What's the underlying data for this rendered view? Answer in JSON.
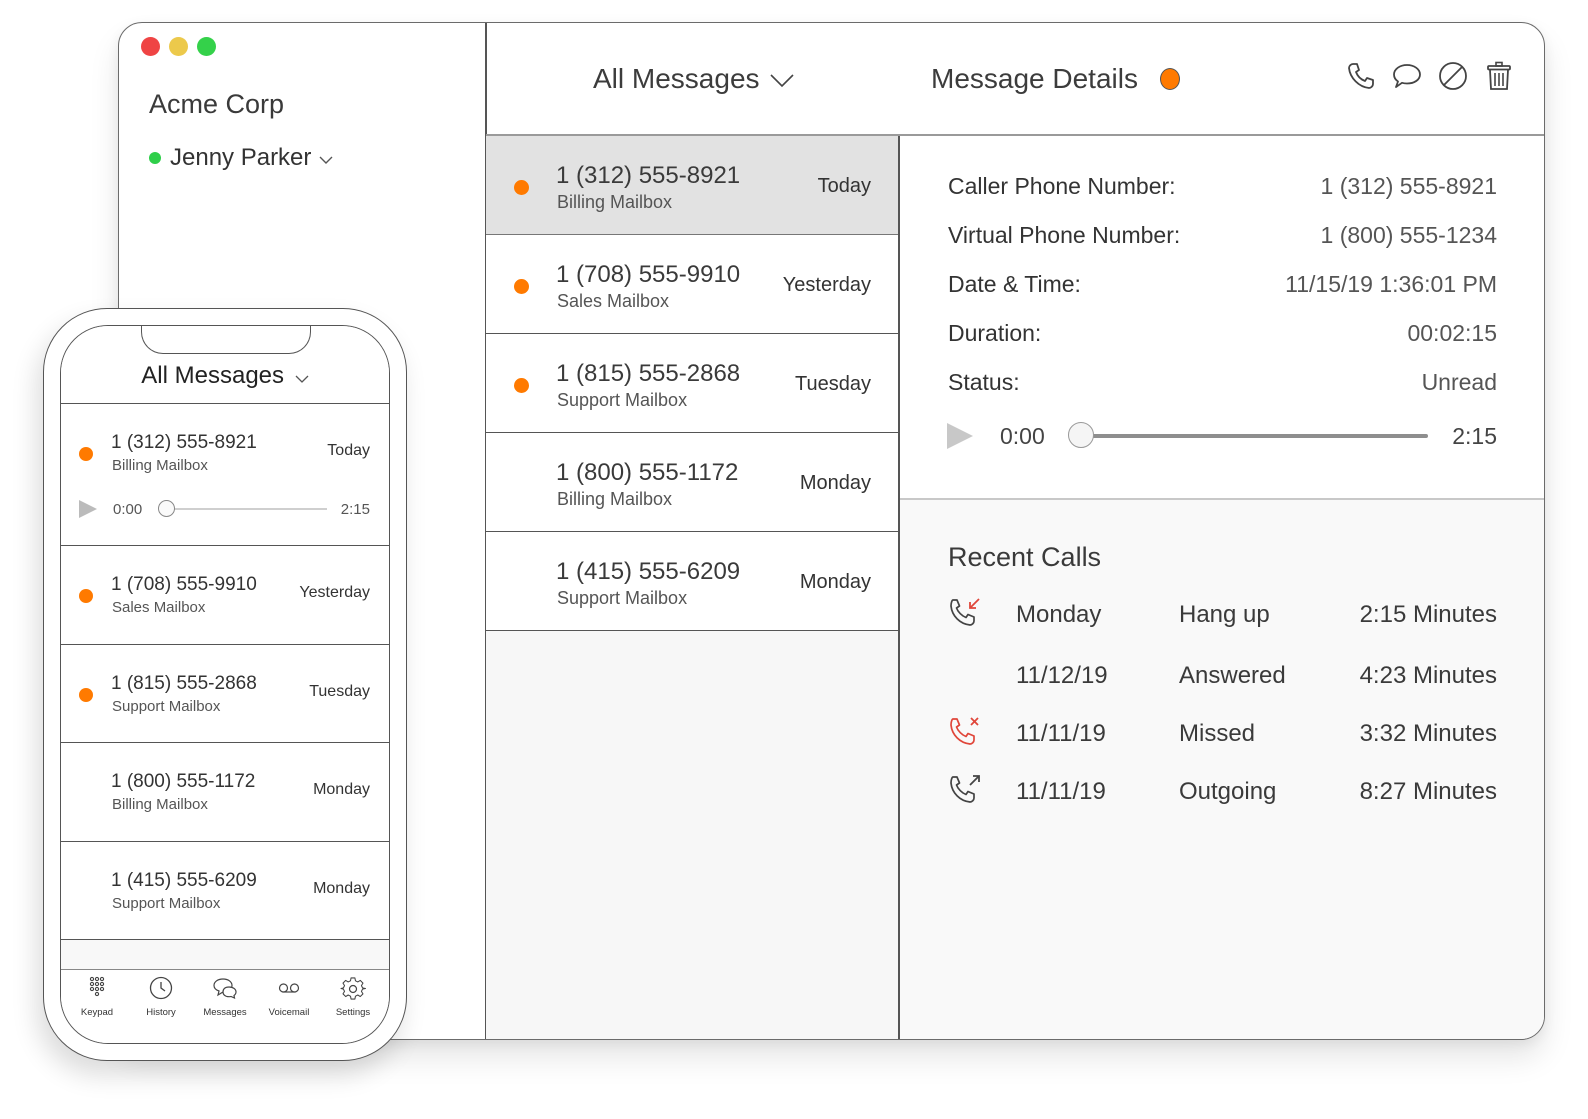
{
  "colors": {
    "unread": "#ff7a00",
    "online": "#2fcf4a",
    "traffic_close": "#ef4444",
    "traffic_minimize": "#ecc94b",
    "traffic_maximize": "#34d14a",
    "missed": "#e0463a"
  },
  "desktop": {
    "sidebar": {
      "org_name": "Acme Corp",
      "user_name": "Jenny Parker",
      "user_status": "online"
    },
    "list_header": {
      "title": "All Messages",
      "dropdown_icon": "chevron-down-icon"
    },
    "details_header": {
      "title": "Message Details",
      "status": "unread"
    },
    "toolbar": {
      "call_icon": "phone-icon",
      "message_icon": "chat-bubble-icon",
      "block_icon": "block-icon",
      "delete_icon": "trash-icon"
    },
    "messages": [
      {
        "number": "1 (312) 555-8921",
        "mailbox": "Billing Mailbox",
        "when": "Today",
        "unread": true,
        "selected": true
      },
      {
        "number": "1 (708) 555-9910",
        "mailbox": "Sales Mailbox",
        "when": "Yesterday",
        "unread": true,
        "selected": false
      },
      {
        "number": "1 (815) 555-2868",
        "mailbox": "Support Mailbox",
        "when": "Tuesday",
        "unread": true,
        "selected": false
      },
      {
        "number": "1 (800) 555-1172",
        "mailbox": "Billing Mailbox",
        "when": "Monday",
        "unread": false,
        "selected": false
      },
      {
        "number": "1 (415) 555-6209",
        "mailbox": "Support Mailbox",
        "when": "Monday",
        "unread": false,
        "selected": false
      }
    ],
    "details": {
      "fields": [
        {
          "label": "Caller Phone Number:",
          "value": "1 (312) 555-8921"
        },
        {
          "label": "Virtual Phone Number:",
          "value": "1 (800) 555-1234"
        },
        {
          "label": "Date & Time:",
          "value": "11/15/19 1:36:01 PM"
        },
        {
          "label": "Duration:",
          "value": "00:02:15"
        },
        {
          "label": "Status:",
          "value": "Unread"
        }
      ],
      "player": {
        "current": "0:00",
        "total": "2:15",
        "progress": 0
      }
    },
    "recent_calls": {
      "title": "Recent Calls",
      "rows": [
        {
          "icon": "incoming-call-icon",
          "date": "Monday",
          "type": "Hang up",
          "duration": "2:15 Minutes"
        },
        {
          "icon": "",
          "date": "11/12/19",
          "type": "Answered",
          "duration": "4:23 Minutes"
        },
        {
          "icon": "missed-call-icon",
          "date": "11/11/19",
          "type": "Missed",
          "duration": "3:32 Minutes"
        },
        {
          "icon": "outgoing-call-icon",
          "date": "11/11/19",
          "type": "Outgoing",
          "duration": "8:27 Minutes"
        }
      ]
    }
  },
  "mobile": {
    "header": {
      "title": "All Messages"
    },
    "messages": [
      {
        "number": "1 (312) 555-8921",
        "mailbox": "Billing Mailbox",
        "when": "Today",
        "unread": true,
        "expanded": true,
        "player": {
          "current": "0:00",
          "total": "2:15",
          "progress": 0
        }
      },
      {
        "number": "1 (708) 555-9910",
        "mailbox": "Sales Mailbox",
        "when": "Yesterday",
        "unread": true
      },
      {
        "number": "1 (815) 555-2868",
        "mailbox": "Support Mailbox",
        "when": "Tuesday",
        "unread": true
      },
      {
        "number": "1 (800) 555-1172",
        "mailbox": "Billing Mailbox",
        "when": "Monday",
        "unread": false
      },
      {
        "number": "1 (415) 555-6209",
        "mailbox": "Support Mailbox",
        "when": "Monday",
        "unread": false
      }
    ],
    "tabs": [
      {
        "label": "Keypad",
        "icon": "keypad-icon"
      },
      {
        "label": "History",
        "icon": "clock-icon"
      },
      {
        "label": "Messages",
        "icon": "messages-icon"
      },
      {
        "label": "Voicemail",
        "icon": "voicemail-icon"
      },
      {
        "label": "Settings",
        "icon": "gear-icon"
      }
    ]
  }
}
